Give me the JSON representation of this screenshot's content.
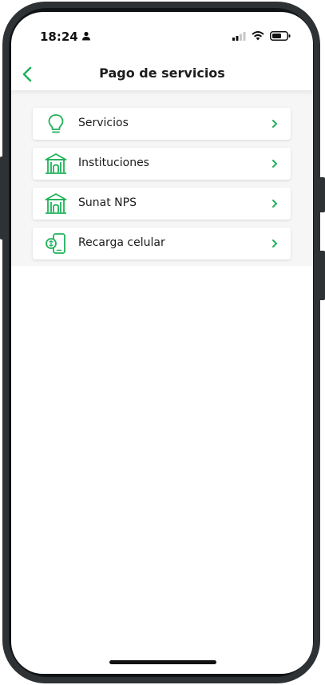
{
  "status_bar": {
    "time": "18:24",
    "icons": [
      "person-icon",
      "signal-icon",
      "wifi-icon",
      "battery-icon"
    ]
  },
  "header": {
    "back_icon": "chevron-left-icon",
    "title": "Pago de servicios"
  },
  "menu": {
    "items": [
      {
        "label": "Servicios",
        "icon": "lightbulb-icon"
      },
      {
        "label": "Instituciones",
        "icon": "institution-icon"
      },
      {
        "label": "Sunat NPS",
        "icon": "institution-icon"
      },
      {
        "label": "Recarga celular",
        "icon": "mobile-recharge-icon"
      }
    ],
    "chevron_icon": "chevron-right-icon"
  },
  "colors": {
    "accent": "#1fb25a",
    "screen_background": "#ffffff",
    "list_background": "#f6f6f6",
    "frame": "#2e3234"
  }
}
